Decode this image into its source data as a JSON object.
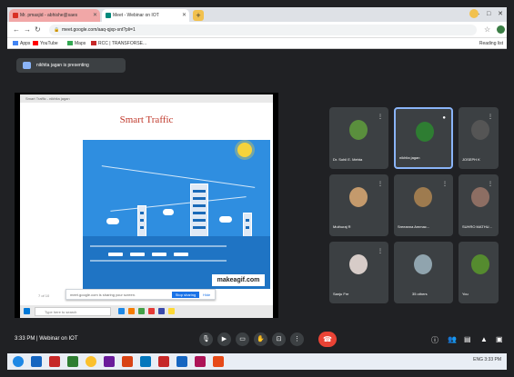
{
  "browser": {
    "tabs": [
      {
        "label": "Mr. pmasjid - abhishe@saes",
        "active": false
      },
      {
        "label": "Meet - Webinar on IOT",
        "active": true
      }
    ],
    "new_tab": "+",
    "window_buttons": [
      "–",
      "□",
      "✕"
    ],
    "address": "meet.google.com/aaq-qjxp-snt?pli=1",
    "bookmarks": [
      "Apps",
      "YouTube",
      "Maps",
      "RCC | TRANSFORSE..."
    ],
    "reading_list": "Reading list"
  },
  "meet": {
    "presenting_text": "nikhita jagan is presenting",
    "slide": {
      "window_title": "Smart Traffic - nikhita jagan",
      "title": "Smart Traffic",
      "brand": "makeagif.com",
      "notification": "meet.google.com is sharing your screen.",
      "stop_sharing": "Stop sharing",
      "hide": "Hide",
      "page_label": "7 of 10",
      "search_placeholder": "Type here to search"
    },
    "participants": [
      {
        "name": "Dr. Sohil E. Mehta",
        "color": "#5a8f3d"
      },
      {
        "name": "nikhita jagan",
        "color": "#2e7d32",
        "active": true
      },
      {
        "name": "JOSEPH K",
        "color": "#555555"
      },
      {
        "name": "Muthuraj R",
        "color": "#c49a6c"
      },
      {
        "name": "Sreeanna Ammac...",
        "color": "#9e7b4f"
      },
      {
        "name": "SUHRO MATHU...",
        "color": "#8d6e63"
      },
      {
        "name": "Sanju Fre",
        "color": "#d7ccc8"
      },
      {
        "name": "35 others",
        "color": "#90a4ae"
      },
      {
        "name": "You",
        "color": "#558b2f"
      }
    ],
    "time_text": "3:33 PM  |  Webinar on IOT",
    "controls": [
      "mic",
      "camera",
      "captions",
      "raise-hand",
      "present",
      "more"
    ],
    "right_controls": [
      "info",
      "people",
      "chat",
      "activities"
    ]
  },
  "os_taskbar": {
    "tray_text": "ENG  3:33 PM"
  },
  "colors": {
    "meet_bg": "#202124",
    "tile_bg": "#3c4043",
    "leave_red": "#ea4335",
    "accent_blue": "#1a73e8",
    "slide_title_red": "#c0392b"
  }
}
